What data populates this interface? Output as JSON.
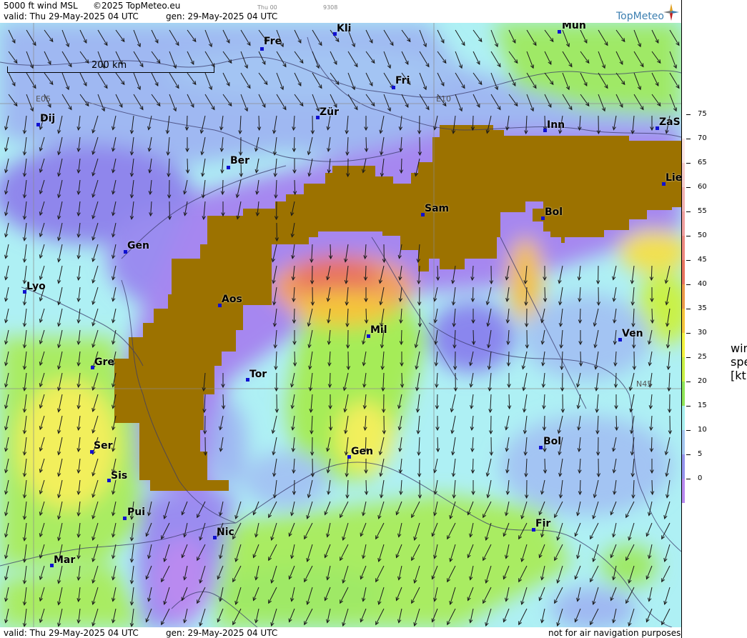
{
  "header": {
    "title": "5000 ft wind MSL",
    "copyright": "©2025 TopMeteo.eu",
    "time_small": "Thu 00",
    "code_small": "9308",
    "valid": "valid:  Thu  29-May-2025  04 UTC",
    "gen": "gen: 29-May-2025 04 UTC",
    "brand": "TopMeteo"
  },
  "footer": {
    "valid": "valid:  Thu  29-May-2025  04 UTC",
    "gen": "gen: 29-May-2025 04 UTC",
    "disclaimer": "not for air navigation purposes"
  },
  "scale_bar": {
    "label": "200 km"
  },
  "grid_labels": {
    "e05": "E05",
    "e10": "E10",
    "n45": "N45"
  },
  "cities": [
    {
      "name": "Kli"
    },
    {
      "name": "Mun"
    },
    {
      "name": "Fre"
    },
    {
      "name": "Fri"
    },
    {
      "name": "Dij"
    },
    {
      "name": "Zür"
    },
    {
      "name": "Inn"
    },
    {
      "name": "ZaS"
    },
    {
      "name": "Ber"
    },
    {
      "name": "Lie"
    },
    {
      "name": "Sam"
    },
    {
      "name": "Bol"
    },
    {
      "name": "Gen"
    },
    {
      "name": "Lyo"
    },
    {
      "name": "Aos"
    },
    {
      "name": "Mil"
    },
    {
      "name": "Ven"
    },
    {
      "name": "Gre"
    },
    {
      "name": "Tor"
    },
    {
      "name": "Ser"
    },
    {
      "name": "Gen"
    },
    {
      "name": "Bol"
    },
    {
      "name": "Sis"
    },
    {
      "name": "Pui"
    },
    {
      "name": "Fir"
    },
    {
      "name": "Nic"
    },
    {
      "name": "Mar"
    }
  ],
  "legend": {
    "unit_label": "wind speed [kt]",
    "ticks": [
      "75",
      "70",
      "65",
      "60",
      "55",
      "50",
      "45",
      "40",
      "35",
      "30",
      "25",
      "20",
      "15",
      "10",
      "5",
      "0"
    ],
    "colors": [
      "#ffffff",
      "#fbe6e6",
      "#f6cccc",
      "#f2b3b3",
      "#f0a0a0",
      "#ee8a80",
      "#e8745e",
      "#ec9a48",
      "#f5c43a",
      "#f3f33e",
      "#c9f147",
      "#8fe65a",
      "#a8f0f0",
      "#a3c6f0",
      "#9494ee",
      "#b98af0"
    ]
  },
  "colors": {
    "terrain": "#9c7200",
    "calm": "#b98af0",
    "light": "#9a9af0",
    "blue": "#a3c4f3",
    "cyan": "#aef0f4",
    "green": "#9fe966",
    "yellow": "#f2ef5c",
    "orange": "#f0a060",
    "red": "#e8745e"
  }
}
